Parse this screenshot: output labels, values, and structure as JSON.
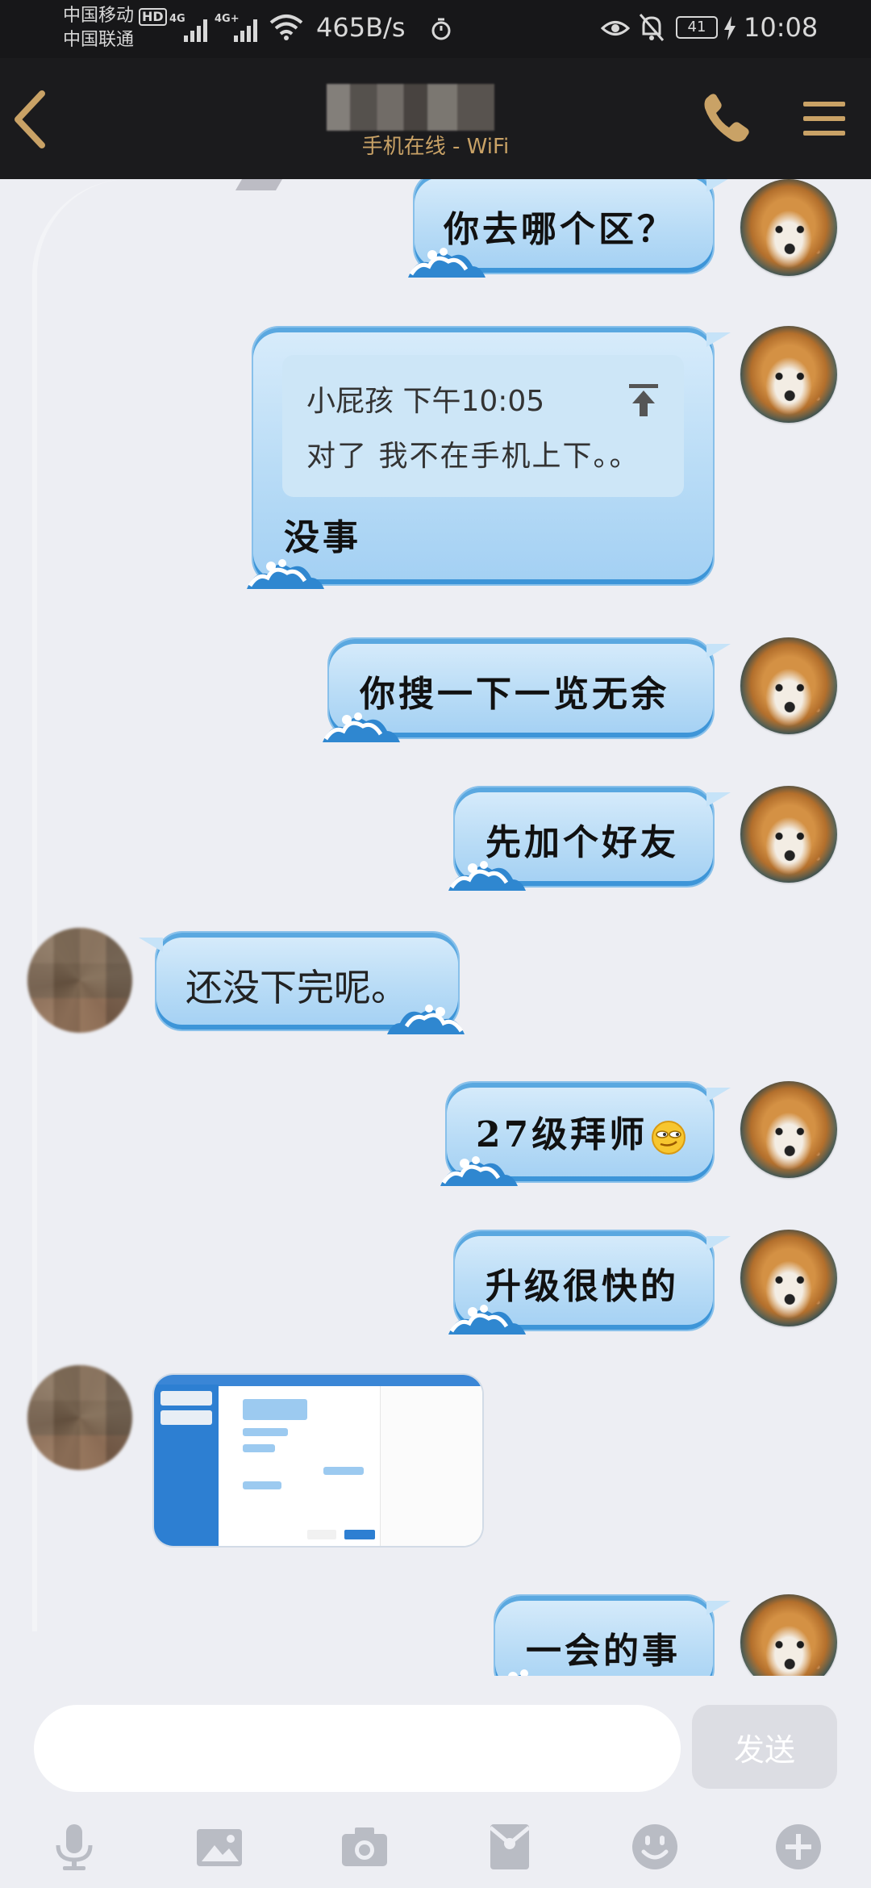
{
  "status_bar": {
    "carrier_1": "中国移动",
    "hd": "HD",
    "carrier_2": "中国联通",
    "sig1_label": "4G",
    "sig2_label": "4G+",
    "net_speed": "465B/s",
    "battery": "41",
    "time": "10:08"
  },
  "header": {
    "status": "手机在线 - WiFi"
  },
  "messages": [
    {
      "side": "out",
      "text": "你去哪个区？"
    },
    {
      "side": "out",
      "quote_header": "小屁孩 下午10:05",
      "quote_body": "对了 我不在手机上下。。",
      "text": "没事"
    },
    {
      "side": "out",
      "text": "你搜一下一览无余"
    },
    {
      "side": "out",
      "text": "先加个好友"
    },
    {
      "side": "in",
      "text": "还没下完呢。"
    },
    {
      "side": "out",
      "text": "27级拜师",
      "emoji": "smirk-emoji"
    },
    {
      "side": "out",
      "text": "升级很快的"
    },
    {
      "side": "in",
      "type": "image",
      "description": "screenshot-thumbnail"
    },
    {
      "side": "out",
      "text": "一会的事"
    }
  ],
  "input": {
    "value": "",
    "placeholder": ""
  },
  "send_label": "发送",
  "toolbar_icons": [
    "mic-icon",
    "image-icon",
    "camera-icon",
    "red-packet-icon",
    "emoji-icon",
    "plus-icon"
  ],
  "colors": {
    "header_bg": "#1b1b1d",
    "accent_gold": "#c9a266",
    "chat_bg": "#edeef3",
    "bubble_blue": "#b9dcf6"
  }
}
